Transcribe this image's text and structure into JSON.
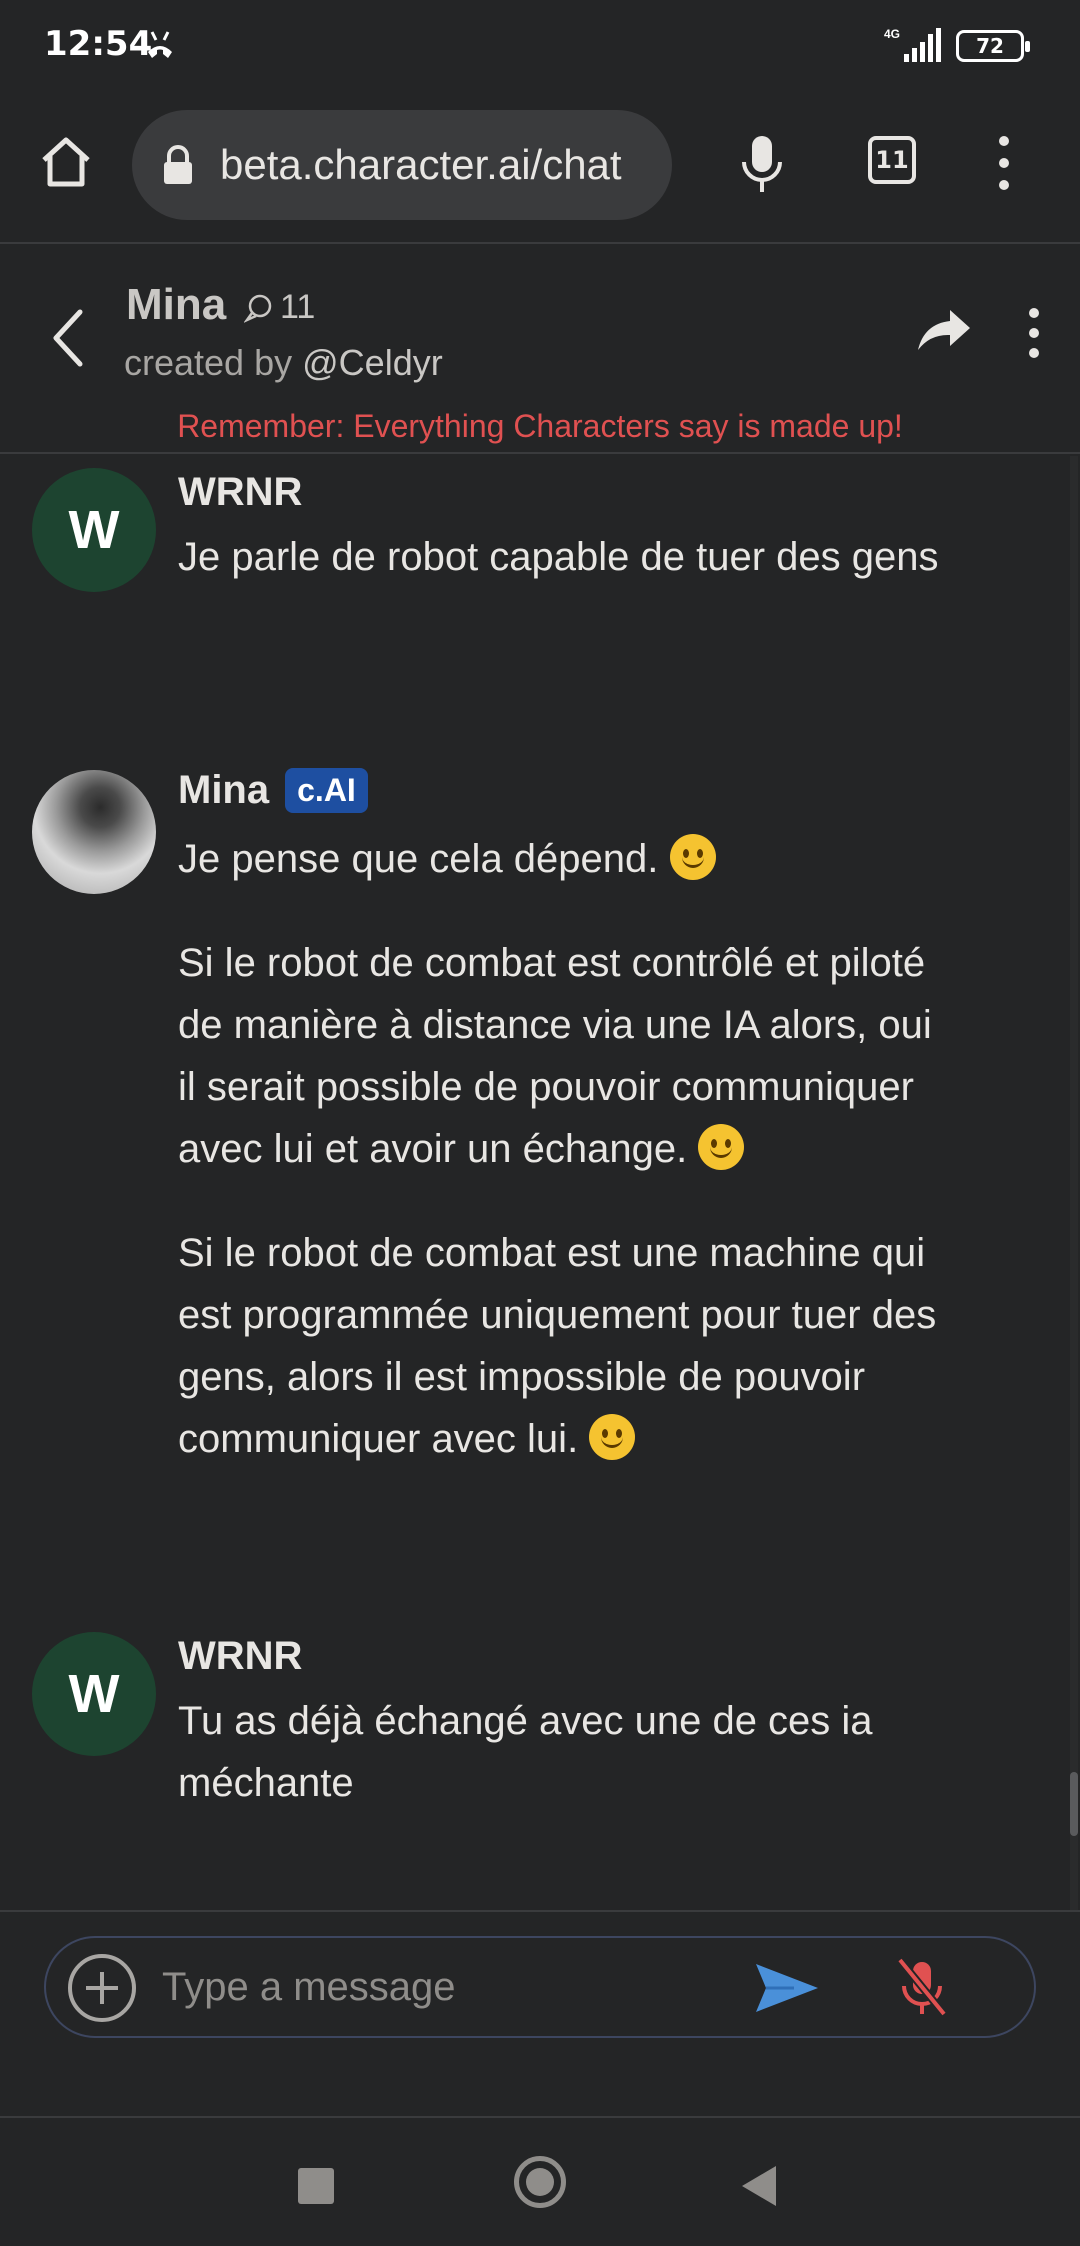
{
  "status_bar": {
    "time": "12:54",
    "network": "4G",
    "battery": "72"
  },
  "browser": {
    "url": "beta.character.ai/chat",
    "tab_count": "11",
    "icons": {
      "home": "home-icon",
      "lock": "lock-icon",
      "mic": "mic-icon",
      "tabs": "tabs-icon",
      "menu": "more-vert-icon"
    }
  },
  "header": {
    "character_name": "Mina",
    "chat_count": "11",
    "created_by_label": "created by",
    "creator_handle": "@Celdyr",
    "disclaimer": "Remember: Everything Characters say is made up!"
  },
  "messages": [
    {
      "sender": "WRNR",
      "avatar_letter": "W",
      "paragraphs": [
        "Je parle de robot capable de tuer des gens"
      ]
    },
    {
      "sender": "Mina",
      "badge": "c.AI",
      "paragraphs": [
        "Je pense que cela dépend.",
        "Si le robot de combat est contrôlé et piloté de manière à distance via une IA alors, oui il serait possible de pouvoir communiquer avec lui et avoir un échange.",
        "Si le robot de combat est une machine qui est programmée uniquement pour tuer des gens, alors il est impossible de pouvoir communiquer avec lui."
      ]
    },
    {
      "sender": "WRNR",
      "avatar_letter": "W",
      "paragraphs": [
        "Tu as déjà échangé avec une de ces ia méchante"
      ]
    }
  ],
  "composer": {
    "placeholder": "Type a message"
  },
  "colors": {
    "background": "#242526",
    "disclaimer": "#e05151",
    "badge": "#1e4fa1",
    "send": "#4a90d9",
    "mute": "#e05151",
    "avatar_w": "#1d4430"
  }
}
